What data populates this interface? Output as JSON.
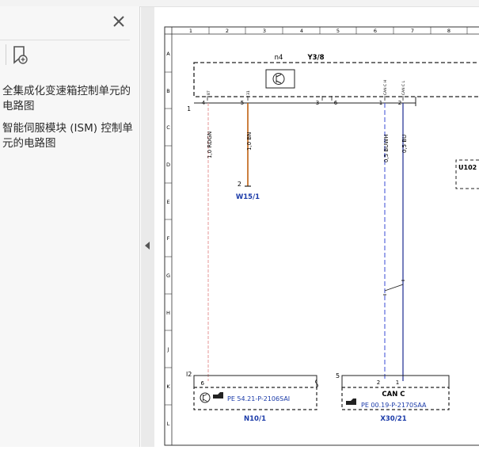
{
  "sidebar": {
    "bookmarks": [
      "全集成化变速箱控制单元的电路图",
      "智能伺服模块 (ISM) 控制单元的电路图"
    ]
  },
  "diagram": {
    "column_numbers": [
      "1",
      "2",
      "3",
      "4",
      "5",
      "6",
      "7",
      "8"
    ],
    "row_letters": [
      "A",
      "B",
      "C",
      "D",
      "E",
      "F",
      "G",
      "H",
      "J",
      "K",
      "L"
    ],
    "top_module": {
      "label": "n4",
      "code": "Y3/8",
      "corner_pin": "1"
    },
    "top_connector_pins": [
      "4",
      "5",
      "3",
      "6",
      "1",
      "2"
    ],
    "wires": [
      {
        "label": "1,0 RDGN",
        "color": "#e8a0a0"
      },
      {
        "label": "1,0 BN",
        "color": "#c06010"
      },
      {
        "label": "0,5 BUWH",
        "color": "#4a5bd8"
      },
      {
        "label": "0,5 BU",
        "color": "#1a2a90"
      }
    ],
    "pin_tiny_labels": [
      "87",
      "31",
      "CAN C H",
      "CAN C L"
    ],
    "ground": {
      "pin": "2",
      "code": "W15/1"
    },
    "right_module": "U102",
    "bottom_left": {
      "module_label": "l2",
      "pin": "6",
      "ref": "PE 54.21-P-2106SAI",
      "code": "N10/1"
    },
    "bottom_right": {
      "module_label": "5",
      "pins": [
        "2",
        "1"
      ],
      "title": "CAN C",
      "ref": "PE 00.19-P-2170SAA",
      "code": "X30/21"
    }
  }
}
